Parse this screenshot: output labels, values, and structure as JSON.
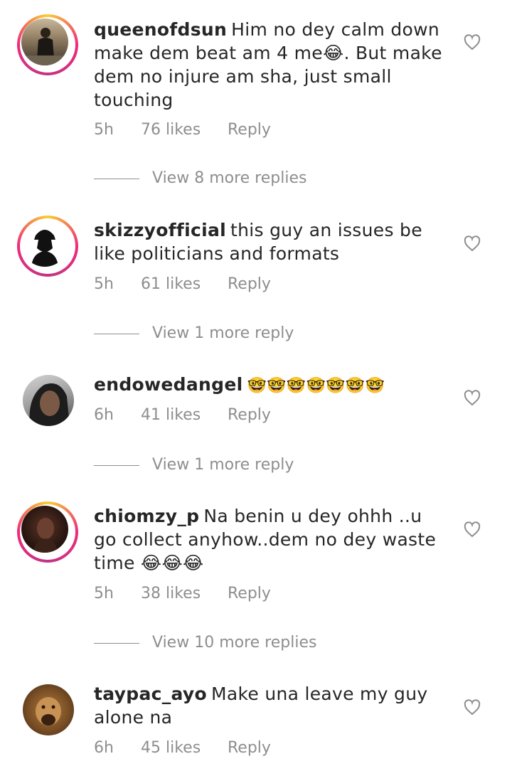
{
  "comments": [
    {
      "username": "queenofdsun",
      "text": "Him no dey calm down make dem beat am 4 me😂. But make dem no injure am sha, just small touching",
      "time": "5h",
      "likes": "76 likes",
      "reply": "Reply",
      "view_replies": "View 8 more replies",
      "has_story_ring": true,
      "avatar_icon": "woman-standing-photo"
    },
    {
      "username": "skizzyofficial",
      "text": "this guy an issues be like politicians and formats",
      "time": "5h",
      "likes": "61 likes",
      "reply": "Reply",
      "view_replies": "View 1 more reply",
      "has_story_ring": true,
      "avatar_icon": "hooded-silhouette"
    },
    {
      "username": "endowedangel",
      "text": "🤓🤓🤓🤓🤓🤓🤓",
      "time": "6h",
      "likes": "41 likes",
      "reply": "Reply",
      "view_replies": "View 1 more reply",
      "has_story_ring": false,
      "avatar_icon": "woman-selfie-photo"
    },
    {
      "username": "chiomzy_p",
      "text": "Na benin u dey ohhh ..u go collect anyhow..dem no dey waste time 😂😂😂",
      "time": "5h",
      "likes": "38 likes",
      "reply": "Reply",
      "view_replies": "View 10 more replies",
      "has_story_ring": true,
      "avatar_icon": "dark-portrait-photo"
    },
    {
      "username": "taypac_ayo",
      "text": "Make una leave my guy alone na",
      "time": "6h",
      "likes": "45 likes",
      "reply": "Reply",
      "has_story_ring": false,
      "avatar_icon": "lion-photo"
    }
  ],
  "colors": {
    "text": "#262626",
    "secondary": "#8e8e8e",
    "story_ring_start": "#f9ce34",
    "story_ring_end": "#ee2a7b"
  },
  "icons": {
    "like": "heart-outline-icon"
  }
}
